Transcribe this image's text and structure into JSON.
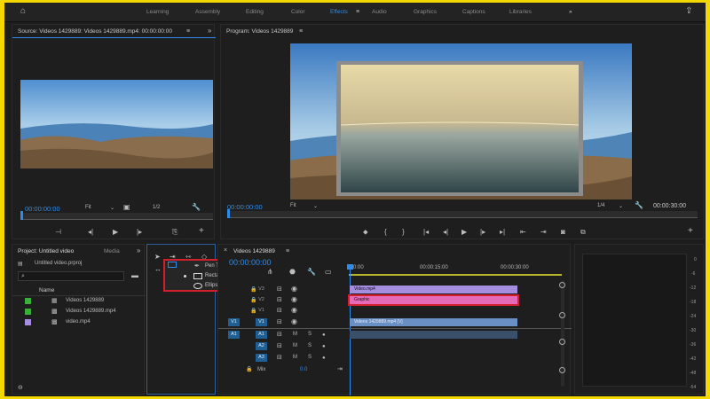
{
  "workspaces": [
    "Learning",
    "Assembly",
    "Editing",
    "Color",
    "Effects",
    "Audio",
    "Graphics",
    "Captions",
    "Libraries"
  ],
  "workspaces_more": "»",
  "source": {
    "title": "Source: Videos 1429889: Videos 1429889.mp4: 00:00:00:00",
    "timecode": "00:00:00:00",
    "fit": "Fit",
    "zoom": "1/2"
  },
  "program": {
    "title": "Program: Videos 1429889",
    "timecode": "00:00:00:00",
    "fit": "Fit",
    "zoom": "1/4",
    "end_timecode": "00:00:30:00"
  },
  "project": {
    "tab": "Project: Untitled video",
    "media_tab": "Media",
    "file": "Untitled video.prproj",
    "header_name": "Name",
    "items": [
      {
        "name": "Videos 1429889",
        "color": "#3ab03a"
      },
      {
        "name": "Videos 1429889.mp4",
        "color": "#3ab03a"
      },
      {
        "name": "video.mp4",
        "color": "#a58de0"
      }
    ]
  },
  "tools_popup": {
    "items": [
      "Pen Tool (P)",
      "Rectangle Tool",
      "Ellipse Tool"
    ]
  },
  "timeline": {
    "tab": "Videos 1429889",
    "timecode": "00:00:00:00",
    "ruler": [
      ":00:00",
      "00:00:15:00",
      "00:00:30:00"
    ],
    "video_tracks": [
      "V3",
      "V2",
      "V1"
    ],
    "audio_tracks": [
      "A1",
      "A2",
      "A3"
    ],
    "mix": "Mix",
    "mix_value": "0.0",
    "clips": {
      "v3": "Video.mp4",
      "v2": "Graphic",
      "v1": "Videos 1429889.mp4 [V]"
    }
  },
  "meter": {
    "labels": [
      "0",
      "-6",
      "-12",
      "-18",
      "-24",
      "-30",
      "-36",
      "-42",
      "-48",
      "-54"
    ]
  },
  "colors": {
    "accent": "#2d8ceb",
    "highlight": "#d11f2c",
    "clip_purple": "#a58de0",
    "clip_pink": "#e56bb8",
    "clip_blue": "#6a8fc4"
  }
}
